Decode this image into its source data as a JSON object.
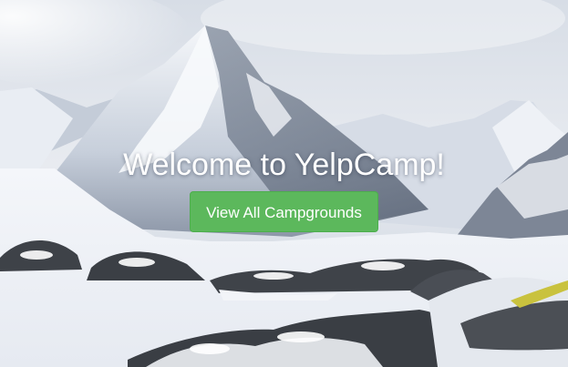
{
  "page": {
    "title": "Welcome to YelpCamp!",
    "cta_label": "View All Campgrounds",
    "background_description_icon": "mountain-snow-image"
  },
  "colors": {
    "button_bg": "#5cb85c",
    "button_border": "#4cae4c",
    "title_text": "#ffffff",
    "sky": "#dfe4ec"
  }
}
